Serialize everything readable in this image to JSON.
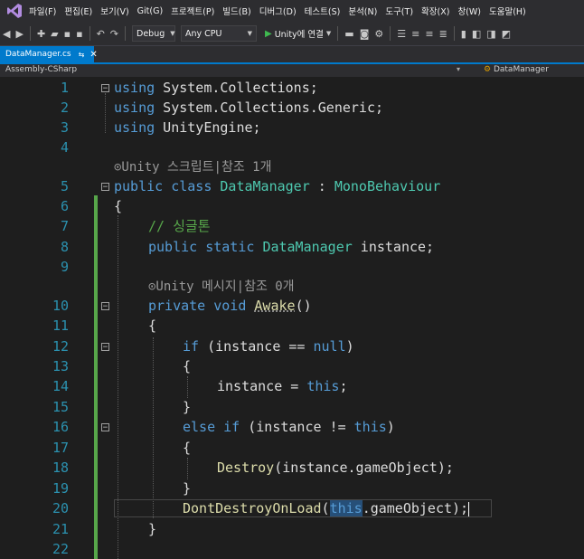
{
  "menu": {
    "items": [
      "파일(F)",
      "편집(E)",
      "보기(V)",
      "Git(G)",
      "프로젝트(P)",
      "빌드(B)",
      "디버그(D)",
      "테스트(S)",
      "분석(N)",
      "도구(T)",
      "확장(X)",
      "창(W)",
      "도움말(H)"
    ]
  },
  "toolbar": {
    "config": "Debug",
    "platform": "Any CPU",
    "run_label": "Unity에 연결"
  },
  "tab": {
    "filename": "DataManager.cs",
    "pin": "⇆",
    "close": "✕"
  },
  "nav": {
    "project": "Assembly-CSharp",
    "class": "DataManager"
  },
  "line_numbers": [
    "1",
    "2",
    "3",
    "4",
    "5",
    "6",
    "7",
    "8",
    "9",
    "10",
    "11",
    "12",
    "13",
    "14",
    "15",
    "16",
    "17",
    "18",
    "19",
    "20",
    "21",
    "22"
  ],
  "hints": {
    "class_hint": "⊙Unity 스크립트|참조 1개",
    "method_hint": "⊙Unity 메시지|참조 0개"
  },
  "code": {
    "l1_kw": "using",
    "l1_rest": " System.Collections;",
    "l2_kw": "using",
    "l2_rest": " System.Collections.Generic;",
    "l3_kw": "using",
    "l3_rest": " UnityEngine;",
    "l5_kw": "public class",
    "l5_name": "DataManager",
    "l5_colon": " : ",
    "l5_base": "MonoBehaviour",
    "l6": "{",
    "l7_comment": "// 싱글톤",
    "l8_kw": "public static",
    "l8_type": "DataManager",
    "l8_rest": " instance;",
    "l10_kw": "private void",
    "l10_name": "Awake",
    "l10_rest": "()",
    "l11": "{",
    "l12_kw": "if",
    "l12_mid": " (instance == ",
    "l12_null": "null",
    "l12_end": ")",
    "l13": "{",
    "l14_a": "instance = ",
    "l14_this": "this",
    "l14_end": ";",
    "l15": "}",
    "l16_kw": "else if",
    "l16_mid": " (instance != ",
    "l16_this": "this",
    "l16_end": ")",
    "l17": "{",
    "l18_fn": "Destroy",
    "l18_rest": "(instance.gameObject);",
    "l19": "}",
    "l20_fn": "DontDestroyOnLoad",
    "l20_open": "(",
    "l20_this": "this",
    "l20_rest": ".gameObject);",
    "l21": "}"
  },
  "colors": {
    "keyword": "#569cd6",
    "type": "#4ec9b0",
    "method": "#dcdcaa",
    "comment": "#57a64a",
    "line_number": "#2b91af",
    "accent": "#007acc"
  }
}
